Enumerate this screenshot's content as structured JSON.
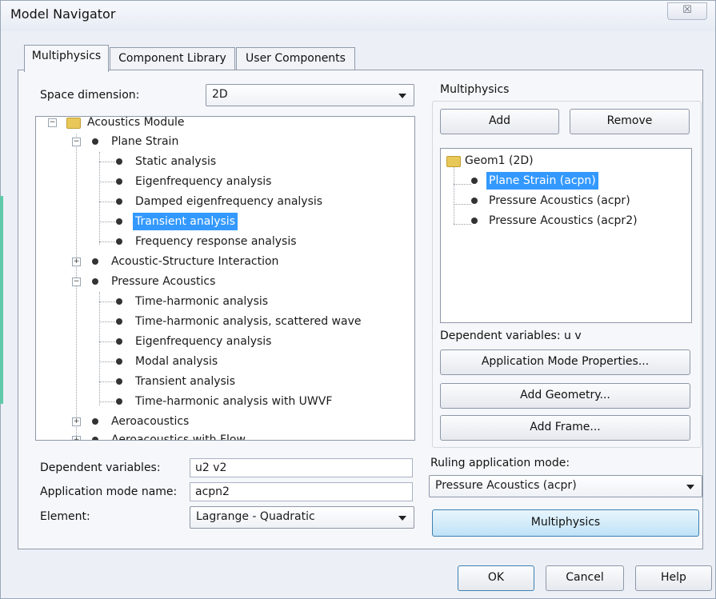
{
  "window": {
    "title": "Model Navigator",
    "close_symbol": "☒"
  },
  "tabs": [
    "Multiphysics",
    "Component Library",
    "User Components"
  ],
  "left": {
    "space_dimension_label": "Space dimension:",
    "space_dimension_value": "2D",
    "tree": {
      "root": "Acoustics Module",
      "plane_strain": "Plane Strain",
      "plane_strain_items": [
        "Static analysis",
        "Eigenfrequency analysis",
        "Damped eigenfrequency analysis",
        "Transient analysis",
        "Frequency response analysis"
      ],
      "acoustic_structure": "Acoustic-Structure Interaction",
      "pressure_acoustics": "Pressure Acoustics",
      "pressure_items": [
        "Time-harmonic analysis",
        "Time-harmonic analysis, scattered wave",
        "Eigenfrequency analysis",
        "Modal analysis",
        "Transient analysis",
        "Time-harmonic analysis with UWVF"
      ],
      "aeroacoustics": "Aeroacoustics",
      "aeroacoustics_flow": "Aeroacoustics with Flow",
      "selected": "Transient analysis"
    },
    "dependent_variables_label": "Dependent variables:",
    "dependent_variables_value": "u2 v2",
    "app_mode_name_label": "Application mode name:",
    "app_mode_name_value": "acpn2",
    "element_label": "Element:",
    "element_value": "Lagrange - Quadratic"
  },
  "right": {
    "group_title": "Multiphysics",
    "add_button": "Add",
    "remove_button": "Remove",
    "list": {
      "geom": "Geom1 (2D)",
      "items": [
        "Plane Strain (acpn)",
        "Pressure Acoustics (acpr)",
        "Pressure Acoustics (acpr2)"
      ]
    },
    "dependent_variables": "Dependent variables:  u v",
    "app_mode_props_button": "Application Mode Properties...",
    "add_geometry_button": "Add Geometry...",
    "add_frame_button": "Add Frame...",
    "ruling_label": "Ruling application mode:",
    "ruling_value": "Pressure Acoustics (acpr)",
    "multiphysics_button": "Multiphysics"
  },
  "footer": {
    "ok": "OK",
    "cancel": "Cancel",
    "help": "Help"
  },
  "colors": {
    "selection": "#3399ff",
    "dialog_bg": "#ecf0f6",
    "accent_button": "#bfe2f7"
  }
}
